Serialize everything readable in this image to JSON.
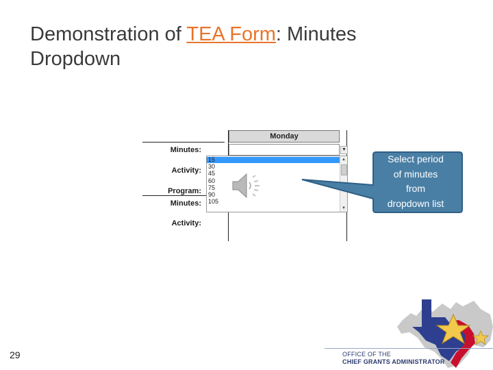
{
  "slide": {
    "title_prefix": "Demonstration of ",
    "title_link": "TEA Form",
    "title_suffix": ": Minutes",
    "title_line2": "Dropdown",
    "number": "29"
  },
  "form": {
    "day_header": "Monday",
    "labels": [
      "Minutes:",
      "Activity:",
      "Program:",
      "Minutes:",
      "Activity:"
    ],
    "options": [
      "15",
      "30",
      "45",
      "60",
      "75",
      "90",
      "105"
    ]
  },
  "callout": {
    "lines": [
      "Select period",
      "of minutes",
      "from",
      "dropdown list"
    ],
    "color": "#4a7fa5"
  },
  "logo": {
    "line1": "OFFICE OF THE",
    "line2": "CHIEF GRANTS ADMINISTRATOR",
    "colors": {
      "red": "#c8102e",
      "blue": "#2e3f8f",
      "gold": "#f2c94c",
      "gray": "#c9c9c9"
    }
  },
  "icons": {
    "speaker": "speaker-icon",
    "dropdown_arrow": "chevron-down-icon"
  }
}
